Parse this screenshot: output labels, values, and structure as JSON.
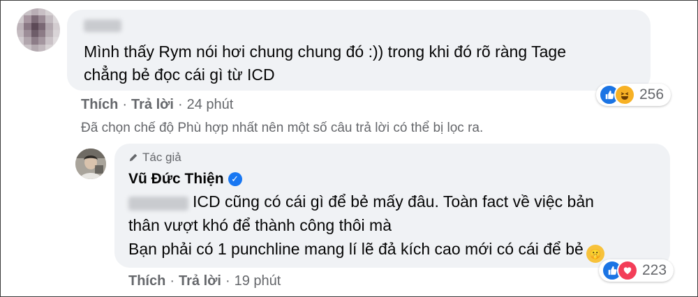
{
  "comment1": {
    "text_line1": "Mình thấy Rym nói hơi chung chung đó :)) trong khi đó rõ ràng Tage",
    "text_line2": "chẳng bẻ đọc cái gì từ ICD",
    "reaction_count": "256",
    "reactions": [
      "like-icon",
      "haha-icon"
    ],
    "like_label": "Thích",
    "reply_label": "Trả lời",
    "time": "24 phút"
  },
  "filter_notice": "Đã chọn chế độ Phù hợp nhất nên một số câu trả lời có thể bị lọc ra.",
  "reply": {
    "author_badge": "Tác giả",
    "author_name": "Vũ Đức Thiện",
    "text_line1": "ICD cũng có cái gì để bẻ mấy đâu. Toàn fact về việc bản",
    "text_line2": "thân vượt khó để thành công thôi mà",
    "text_line3": "Bạn phải có 1 punchline mang lí lẽ đả kích cao mới có cái để bẻ",
    "reaction_count": "223",
    "reactions": [
      "like-icon",
      "love-icon"
    ],
    "like_label": "Thích",
    "reply_label": "Trả lời",
    "time": "19 phút"
  },
  "colors": {
    "bubble": "#f0f2f5",
    "meta_text": "#65676b",
    "like_blue": "#1b74e4",
    "love_red": "#f33e58",
    "haha_yellow": "#f7b125"
  }
}
